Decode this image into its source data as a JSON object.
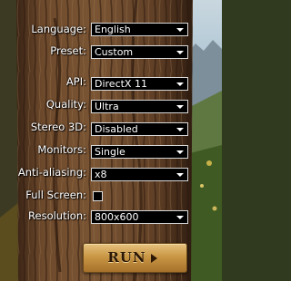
{
  "settings": {
    "language": {
      "label": "Language:",
      "value": "English"
    },
    "preset": {
      "label": "Preset:",
      "value": "Custom"
    },
    "api": {
      "label": "API:",
      "value": "DirectX 11"
    },
    "quality": {
      "label": "Quality:",
      "value": "Ultra"
    },
    "stereo3d": {
      "label": "Stereo 3D:",
      "value": "Disabled"
    },
    "monitors": {
      "label": "Monitors:",
      "value": "Single"
    },
    "antialiasing": {
      "label": "Anti-aliasing:",
      "value": "x8"
    },
    "fullscreen": {
      "label": "Full Screen:",
      "checked": false
    },
    "resolution": {
      "label": "Resolution:",
      "value": "800x600"
    }
  },
  "run_button": {
    "label": "RUN"
  },
  "colors": {
    "bark": "#5b3b22",
    "sky": "#a8c6d8",
    "field_bg": "#000000",
    "button_gold": "#c99745"
  }
}
